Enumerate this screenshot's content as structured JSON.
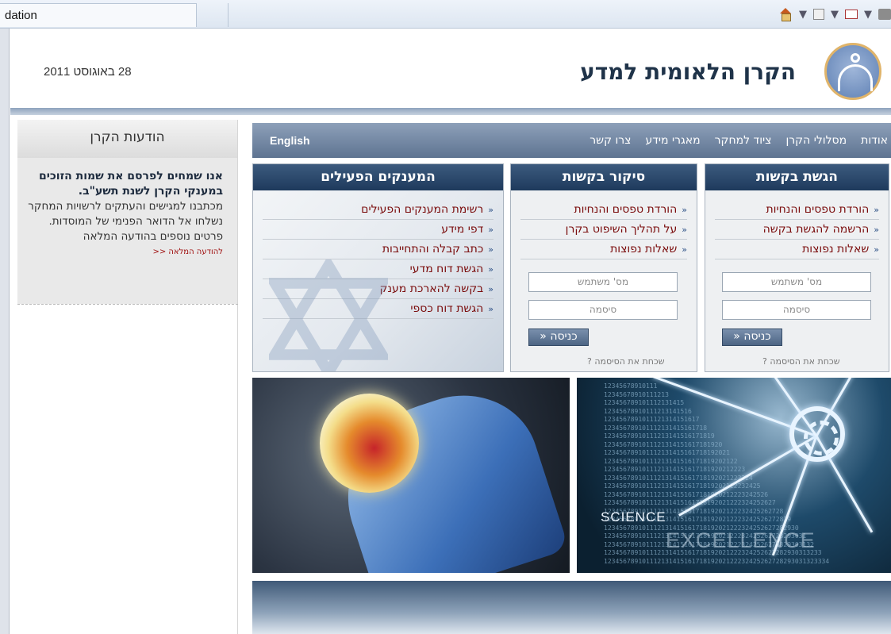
{
  "browser": {
    "tab_title": "dation"
  },
  "header": {
    "date": "28 באוגוסט 2011",
    "site_name": "הקרן הלאומית למדע"
  },
  "nav": {
    "english": "English",
    "links": [
      "אודות",
      "מסלולי הקרן",
      "ציוד למחקר",
      "מאגרי מידע",
      "צרו קשר"
    ]
  },
  "news": {
    "title": "הודעות הקרן",
    "lead": "אנו שמחים לפרסם את שמות הזוכים במענקי הקרן לשנת תשע\"ב.",
    "text": "מכתבנו למגישים והעתקים לרשויות המחקר נשלחו אל הדואר הפנימי של המוסדות. פרטים נוספים בהודעה המלאה",
    "more_link": "להודעה המלאה <<"
  },
  "panels": {
    "submit": {
      "title": "הגשת בקשות",
      "links": [
        "הורדת טפסים והנחיות",
        "הרשמה להגשת בקשה",
        "שאלות נפוצות"
      ],
      "username_placeholder": "מס' משתמש",
      "password_placeholder": "סיסמה",
      "login_label": "כניסה",
      "forgot": "שכחת את הסיסמה ?"
    },
    "review": {
      "title": "סיקור בקשות",
      "links": [
        "הורדת טפסים והנחיות",
        "על תהליך השיפוט בקרן",
        "שאלות נפוצות"
      ],
      "username_placeholder": "מס' משתמש",
      "password_placeholder": "סיסמה",
      "login_label": "כניסה",
      "forgot": "שכחת את הסיסמה ?"
    },
    "grantees": {
      "title": "המענקים הפעילים",
      "links": [
        "רשימת המענקים הפעילים",
        "דפי מידע",
        "כתב קבלה והתחייבות",
        "הגשת דוח מדעי",
        "בקשה להארכת מענק",
        "הגשת דוח כספי"
      ]
    }
  },
  "images": {
    "science_word": "SCIENCE",
    "excellence_word": "EXCELLENCE"
  },
  "icons": {
    "arrow": "«",
    "colors": {
      "nav": "#6d83a1",
      "panel_header": "#2b4a6f",
      "link": "#7a0b0b"
    }
  }
}
